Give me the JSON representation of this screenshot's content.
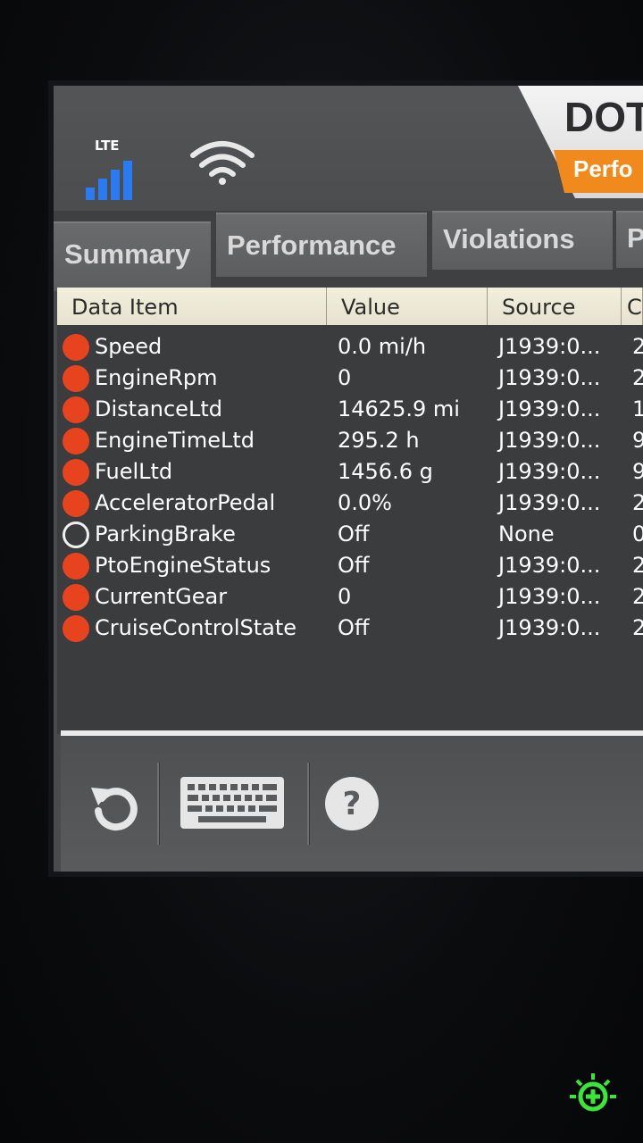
{
  "status": {
    "network_label": "LTE"
  },
  "brand": {
    "title": "DOT",
    "badge": "Perfo"
  },
  "tabs": [
    {
      "label": "Summary"
    },
    {
      "label": "Performance"
    },
    {
      "label": "Violations"
    },
    {
      "label": "P"
    }
  ],
  "table": {
    "headers": [
      "Data Item",
      "Value",
      "Source",
      "C"
    ],
    "rows": [
      {
        "name": "Speed",
        "value": "0.0 mi/h",
        "source": "J1939:0...",
        "extra": "2",
        "active": true
      },
      {
        "name": "EngineRpm",
        "value": "0",
        "source": "J1939:0...",
        "extra": "2",
        "active": true
      },
      {
        "name": "DistanceLtd",
        "value": "14625.9 mi",
        "source": "J1939:0...",
        "extra": "1",
        "active": true
      },
      {
        "name": "EngineTimeLtd",
        "value": "295.2 h",
        "source": "J1939:0...",
        "extra": "9",
        "active": true
      },
      {
        "name": "FuelLtd",
        "value": "1456.6 g",
        "source": "J1939:0...",
        "extra": "9",
        "active": true
      },
      {
        "name": "AcceleratorPedal",
        "value": "0.0%",
        "source": "J1939:0...",
        "extra": "2",
        "active": true
      },
      {
        "name": "ParkingBrake",
        "value": "Off",
        "source": "None",
        "extra": "0",
        "active": false
      },
      {
        "name": "PtoEngineStatus",
        "value": "Off",
        "source": "J1939:0...",
        "extra": "2",
        "active": true
      },
      {
        "name": "CurrentGear",
        "value": "0",
        "source": "J1939:0...",
        "extra": "2",
        "active": true
      },
      {
        "name": "CruiseControlState",
        "value": "Off",
        "source": "J1939:0...",
        "extra": "2",
        "active": true
      }
    ]
  },
  "colors": {
    "active_dot": "#e8431f",
    "signal": "#2a7bf3",
    "brand_accent": "#f08a1c",
    "led": "#39e639"
  },
  "icons": {
    "refresh": "refresh-icon",
    "keyboard": "keyboard-icon",
    "help": "help-icon",
    "wifi": "wifi-icon",
    "signal": "signal-bars-icon",
    "led": "power-led-icon"
  }
}
